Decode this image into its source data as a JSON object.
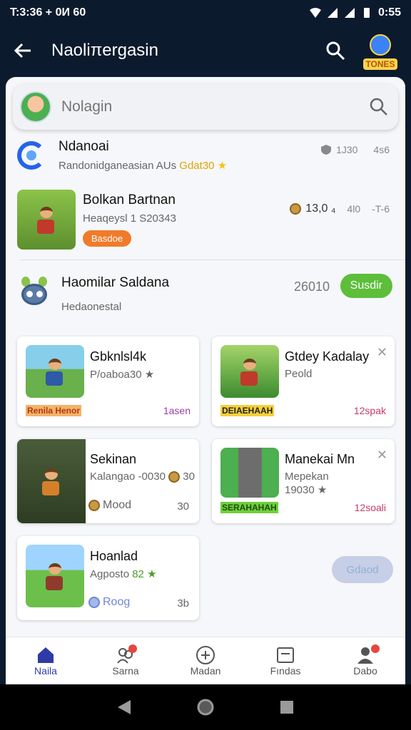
{
  "status_bar": {
    "left": "T:3:36 + 0И 60",
    "time": "0:55"
  },
  "header": {
    "title": "Naoliπergasin",
    "avatar_tag": "TONES"
  },
  "search": {
    "placeholder": "Nolagin"
  },
  "rows": {
    "r1": {
      "title": "Ndanoai",
      "subtitle": "Randonidganeasian AUs",
      "highlight": "Gdat30",
      "meta_a": "1J30",
      "meta_b": "4s6"
    },
    "r2": {
      "title": "Bolkan Bartnan",
      "subtitle": "Heaqeysl 1 S20343",
      "pill": "Basdoe",
      "meta_a": "13,0 ₄",
      "meta_b": "4l0",
      "meta_c": "-T-6"
    },
    "r3": {
      "title": "Haomilar Saldana",
      "subtitle": "Hedaonestal",
      "count": "26010",
      "button": "Susdir"
    }
  },
  "cards": [
    {
      "title": "Gbknlsl4k",
      "sub": "P/oaboa30 ★",
      "tag": "Renila Henor",
      "meta": "1asen"
    },
    {
      "title": "Gtdey Kadalay",
      "sub": "Peold",
      "tag": "DEIAEHAAH",
      "meta": "12spak"
    },
    {
      "title": "Sekinan",
      "sub": "Kalangao -0030",
      "sub2_num": "30",
      "coin_label": "Mood",
      "num": "30"
    },
    {
      "title": "Manekai Mn",
      "sub": "Mepekan",
      "sub2": "19030 ★",
      "tag": "SERAHAHAH",
      "meta": "12soali"
    },
    {
      "title": "Hoanlad",
      "sub": "Agposto",
      "sub_num": "82 ★",
      "coin_label": "Roog",
      "num": "3b"
    }
  ],
  "floating_button": "Gdaod",
  "bottom_nav": [
    {
      "label": "Naila"
    },
    {
      "label": "Sarna"
    },
    {
      "label": "Madan"
    },
    {
      "label": "Fındas"
    },
    {
      "label": "Dabo"
    }
  ],
  "colors": {
    "accent": "#2f3aa6",
    "green": "#5dbe3a",
    "orange": "#f07b2a",
    "header_bg": "#0c1a2e"
  }
}
